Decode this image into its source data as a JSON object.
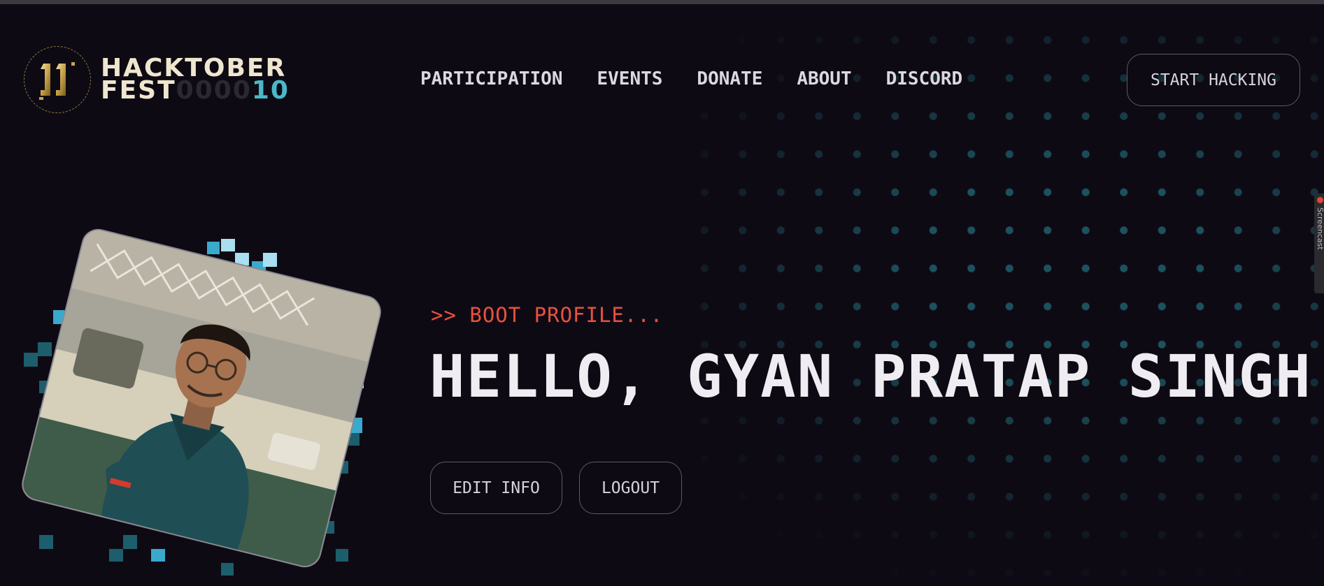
{
  "logo": {
    "line1": "HACKTOBER",
    "line2_word": "FEST",
    "line2_zeros": "0000",
    "line2_ten": "10",
    "icon": "hacktoberfest-11-logo-icon"
  },
  "nav": {
    "items": [
      {
        "label": "PARTICIPATION"
      },
      {
        "label": "EVENTS"
      },
      {
        "label": "DONATE"
      },
      {
        "label": "ABOUT"
      },
      {
        "label": "DISCORD"
      }
    ]
  },
  "header": {
    "cta_label": "START HACKING"
  },
  "side_tab": {
    "label": "Screencast"
  },
  "hero": {
    "boot_text": ">> BOOT PROFILE...",
    "greeting": "HELLO, GYAN PRATAP SINGH",
    "edit_label": "EDIT INFO",
    "logout_label": "LOGOUT"
  },
  "colors": {
    "background": "#0e0a14",
    "accent_red": "#e9513f",
    "accent_teal": "#4ab8c9",
    "logo_gold": "#c8a24a",
    "text": "#efedf2"
  }
}
